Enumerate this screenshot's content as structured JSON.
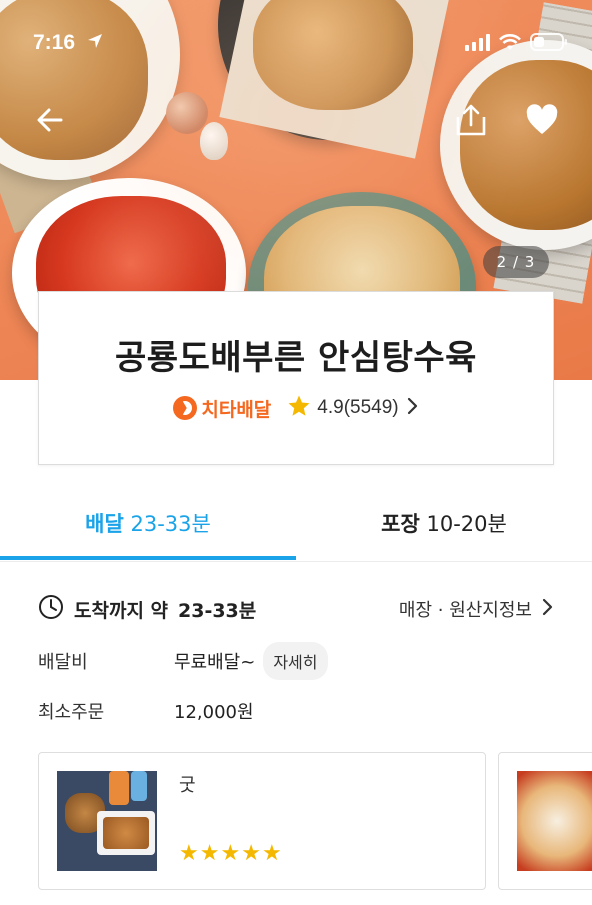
{
  "status_bar": {
    "time": "7:16"
  },
  "hero": {
    "page_indicator": "2 / 3"
  },
  "store": {
    "name": "공룡도배부른 안심탕수육",
    "delivery_brand": "치타배달",
    "rating": "4.9(5549)"
  },
  "tabs": {
    "delivery_label": "배달",
    "delivery_time": "23-33분",
    "pickup_label": "포장",
    "pickup_time": "10-20분"
  },
  "info": {
    "arrival_prefix": "도착까지 약",
    "arrival_time": "23-33분",
    "store_info_link": "매장 · 원산지정보",
    "delivery_fee_label": "배달비",
    "delivery_fee_value": "무료배달~",
    "detail_button": "자세히",
    "min_order_label": "최소주문",
    "min_order_value": "12,000원"
  },
  "reviews": [
    {
      "text": "굿",
      "stars": 5
    }
  ],
  "colors": {
    "accent": "#1aa3e8",
    "cheetah": "#f4681f",
    "star": "#f5b800"
  }
}
